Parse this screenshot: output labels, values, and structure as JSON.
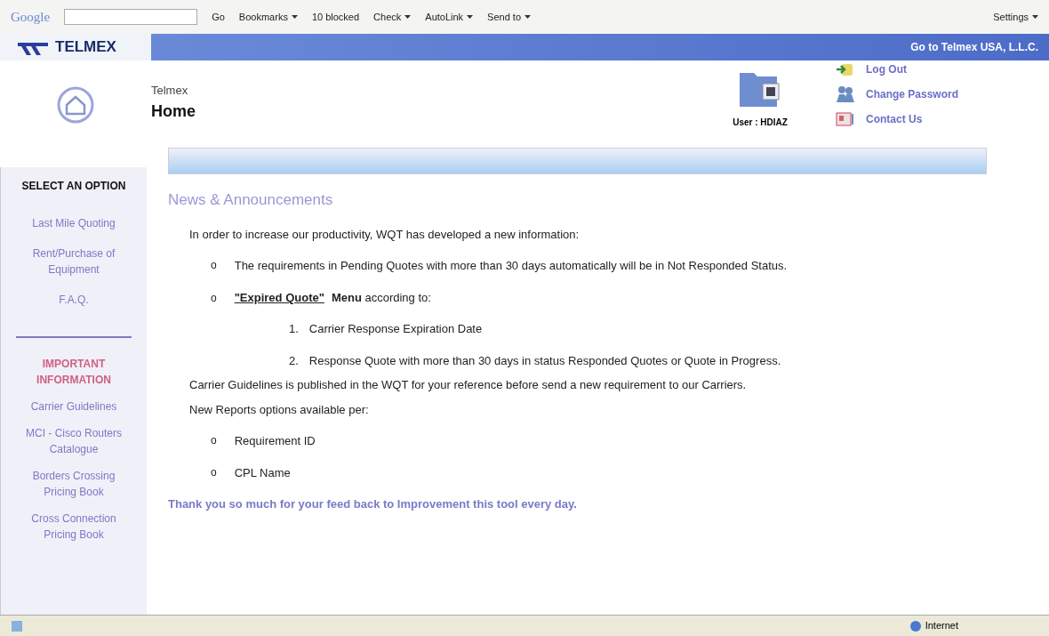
{
  "toolbar": {
    "logo": "Google",
    "buttons": [
      {
        "label": "Go",
        "kind": "plain"
      },
      {
        "label": "Bookmarks",
        "kind": "menu"
      },
      {
        "label": "10 blocked",
        "kind": "plain"
      },
      {
        "label": "Check",
        "kind": "menu"
      },
      {
        "label": "AutoLink",
        "kind": "menu"
      },
      {
        "label": "Send to",
        "kind": "menu"
      }
    ],
    "settings": "Settings"
  },
  "banner": {
    "logo": "TELMEX",
    "link": "Go to Telmex USA, L.L.C."
  },
  "header": {
    "subtitle": "Telmex",
    "title": "Home",
    "user": "User : HDIAZ",
    "links": [
      {
        "label": "Log Out",
        "kind": "logout"
      },
      {
        "label": "Change Password",
        "kind": "password"
      },
      {
        "label": "Contact Us",
        "kind": "contact"
      }
    ]
  },
  "sidebar": {
    "heading": "SELECT AN OPTION",
    "items": [
      "Last Mile Quoting",
      "Rent/Purchase of Equipment",
      "F.A.Q."
    ],
    "important_heading": "IMPORTANT INFORMATION",
    "important_items": [
      "Carrier Guidelines",
      "MCI - Cisco Routers Catalogue",
      "Borders Crossing Pricing Book",
      "Cross Connection Pricing Book"
    ]
  },
  "news": {
    "title": "News & Announcements",
    "intro": "In order to increase our productivity, WQT has developed a new information:",
    "bullets": [
      {
        "marker": "o",
        "text": "The requirements in Pending Quotes with more than 30 days automatically will be in Not Responded Status."
      }
    ],
    "expired_marker": "o",
    "expired_link": "\"Expired Quote\"",
    "expired_rest": "**Menu** according to:",
    "numbered": [
      {
        "number": "1.",
        "text": "Carrier Response Expiration Date"
      },
      {
        "number": "2.",
        "text": "Response Quote with more than 30 days in status Responded Quotes or Quote in Progress."
      }
    ],
    "guidelines": "Carrier Guidelines is published in the WQT for your reference before send a new requirement to our Carriers.",
    "reports_intro": "New Reports options available per:",
    "reports": [
      {
        "marker": "o",
        "text": "Requirement ID"
      },
      {
        "marker": "o",
        "text": "CPL Name"
      }
    ],
    "thanks": "Thank you so much for your feed back to Improvement this tool every day."
  },
  "status_bar": {
    "zone": "Internet"
  }
}
